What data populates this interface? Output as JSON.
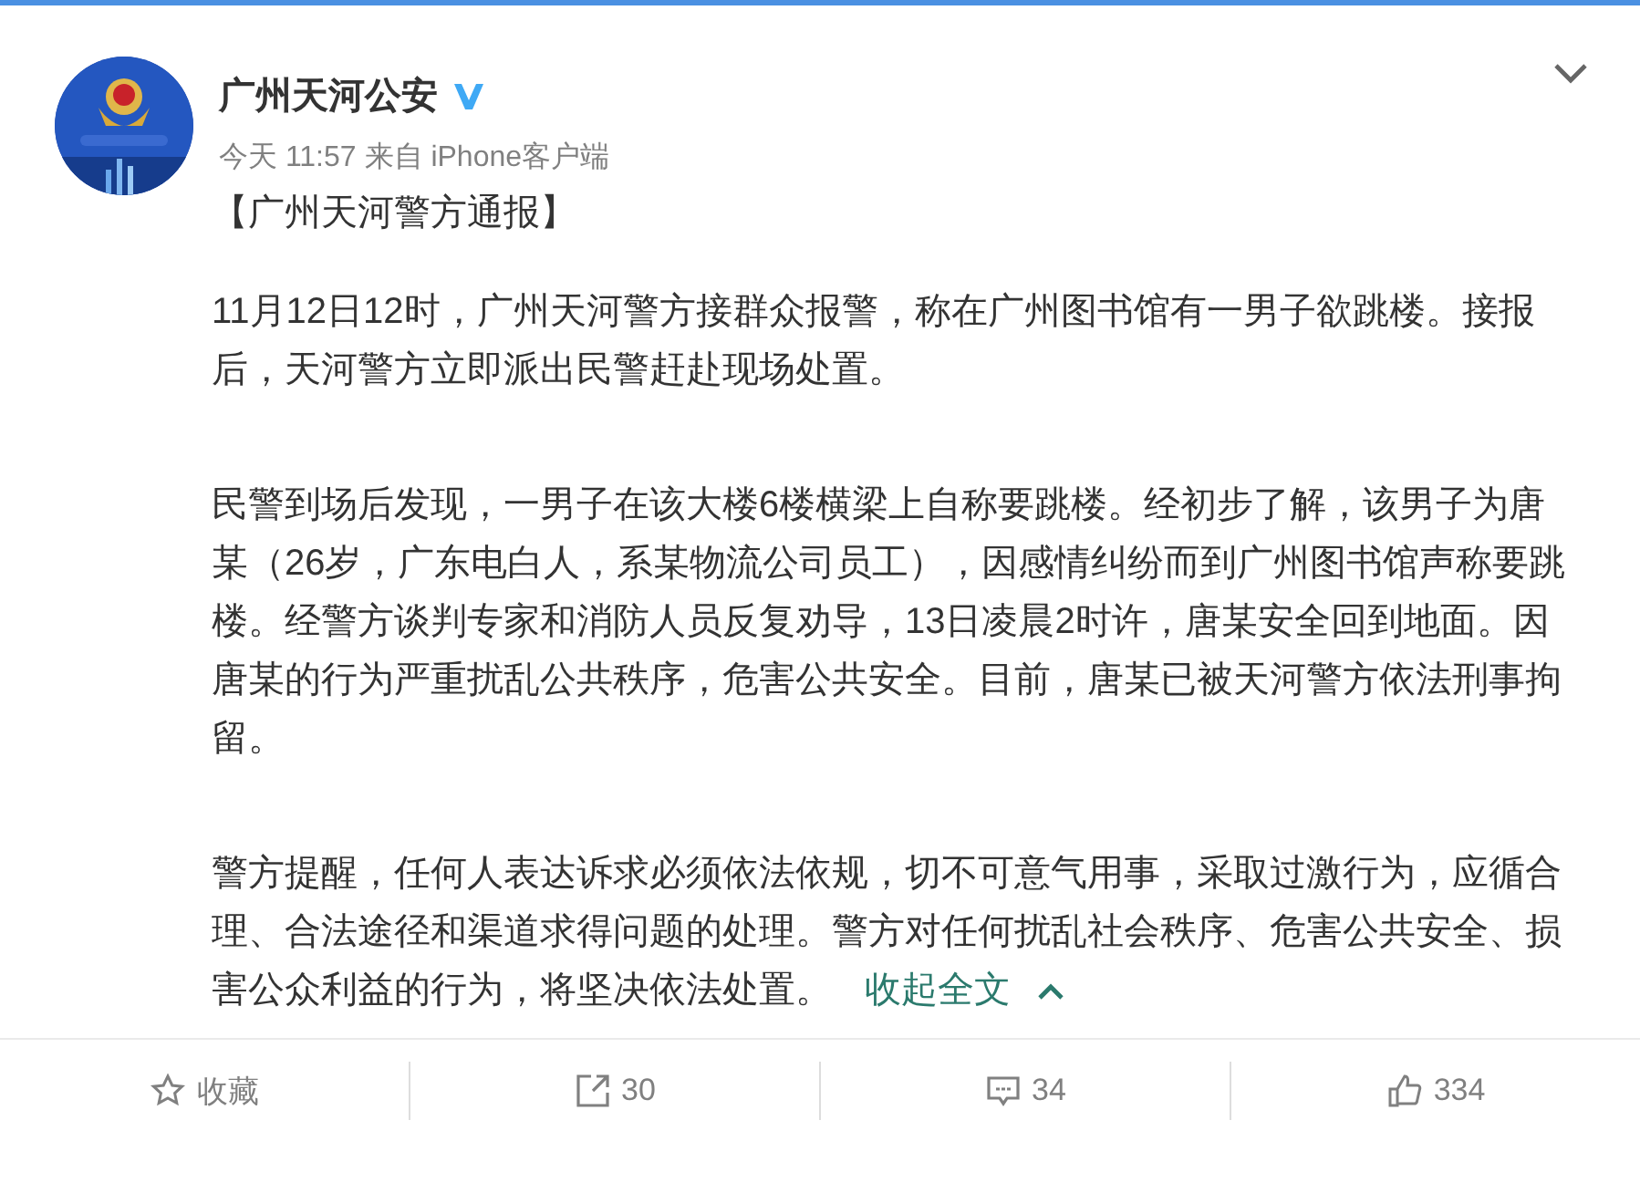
{
  "post": {
    "author": "广州天河公安",
    "time": "今天 11:57",
    "source": "来自 iPhone客户端",
    "paragraphs": [
      "【广州天河警方通报】",
      "11月12日12时，广州天河警方接群众报警，称在广州图书馆有一男子欲跳楼。接报后，天河警方立即派出民警赶赴现场处置。",
      "民警到场后发现，一男子在该大楼6楼横梁上自称要跳楼。经初步了解，该男子为唐某（26岁，广东电白人，系某物流公司员工），因感情纠纷而到广州图书馆声称要跳楼。经警方谈判专家和消防人员反复劝导，13日凌晨2时许，唐某安全回到地面。因唐某的行为严重扰乱公共秩序，危害公共安全。目前，唐某已被天河警方依法刑事拘留。",
      "警方提醒，任何人表达诉求必须依法依规，切不可意气用事，采取过激行为，应循合理、合法途径和渠道求得问题的处理。警方对任何扰乱社会秩序、危害公共安全、损害公众利益的行为，将坚决依法处置。"
    ],
    "collapse_link": "收起全文"
  },
  "actions": [
    {
      "kind": "favorite",
      "label": "收藏"
    },
    {
      "kind": "repost",
      "label": "30"
    },
    {
      "kind": "comment",
      "label": "34"
    },
    {
      "kind": "like",
      "label": "334"
    }
  ]
}
